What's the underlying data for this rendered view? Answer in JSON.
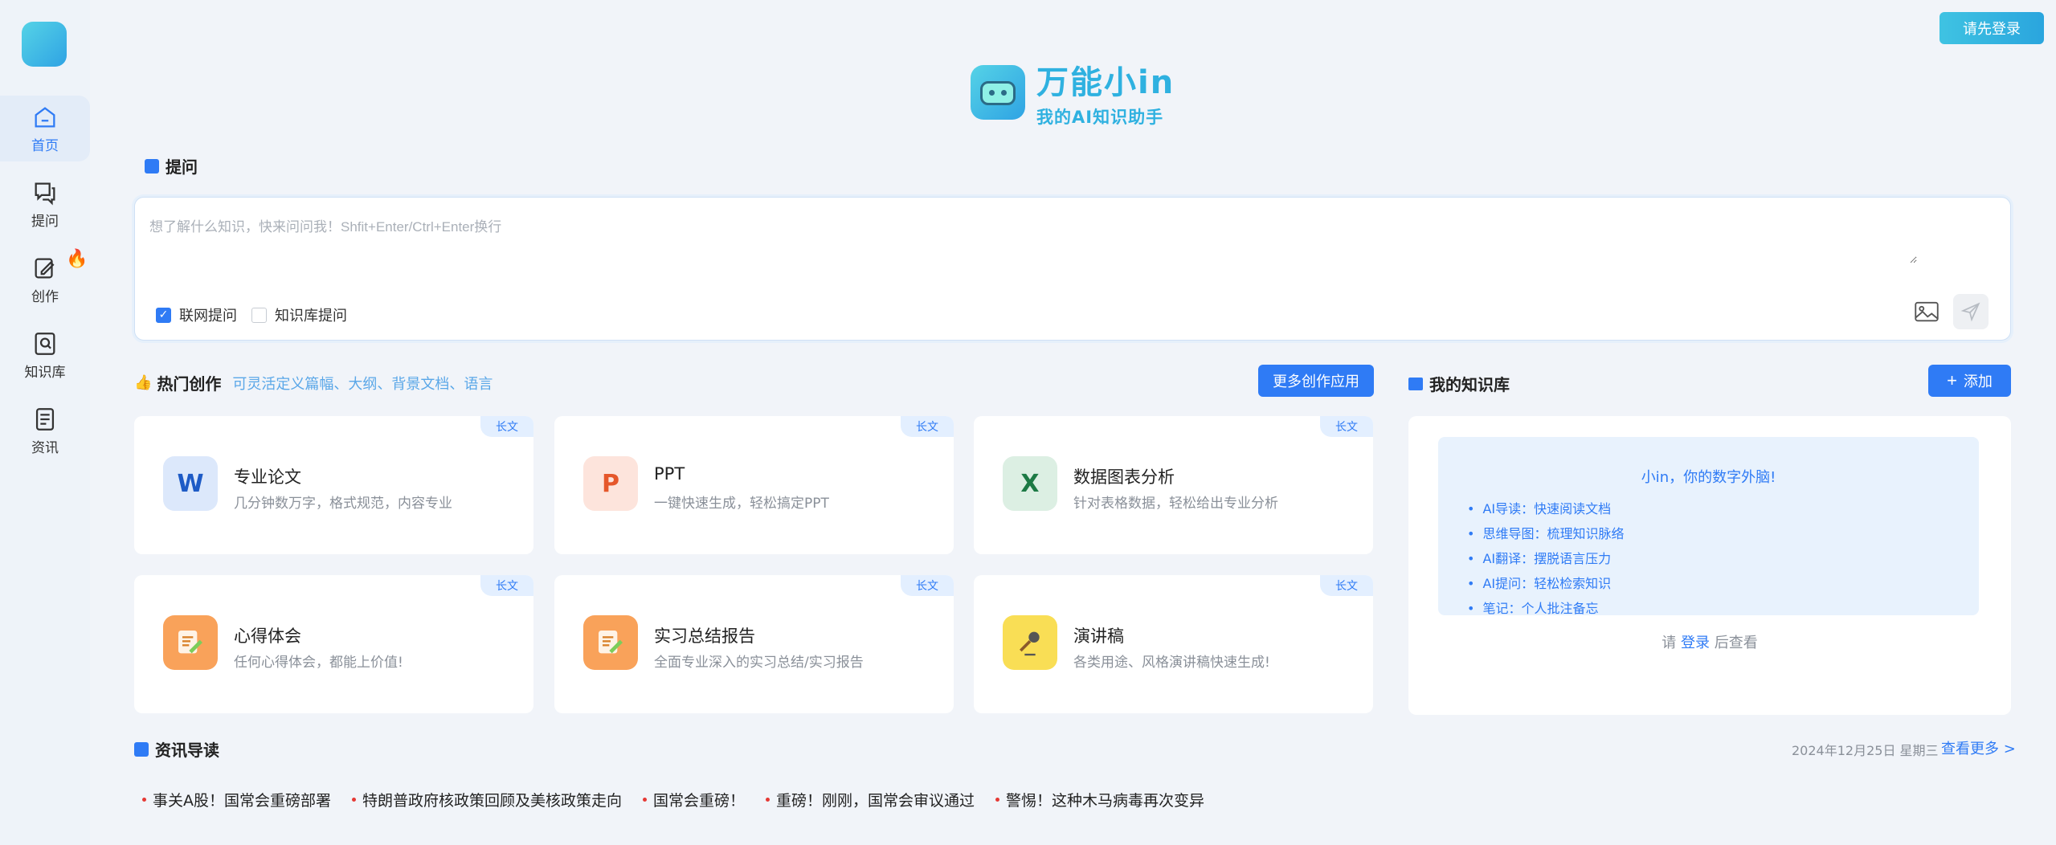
{
  "header": {
    "login_button": "请先登录"
  },
  "brand": {
    "title": "万能小in",
    "subtitle": "我的AI知识助手"
  },
  "sidebar": {
    "items": [
      {
        "label": "首页",
        "icon": "home-icon"
      },
      {
        "label": "提问",
        "icon": "chat-icon"
      },
      {
        "label": "创作",
        "icon": "edit-icon"
      },
      {
        "label": "知识库",
        "icon": "book-search-icon"
      },
      {
        "label": "资讯",
        "icon": "news-icon"
      }
    ],
    "hot_badge_icon": "fire-icon"
  },
  "ask": {
    "section_title": "提问",
    "placeholder": "想了解什么知识，快来问问我！Shfit+Enter/Ctrl+Enter换行",
    "options": [
      {
        "label": "联网提问",
        "checked": true
      },
      {
        "label": "知识库提问",
        "checked": false
      }
    ]
  },
  "hot": {
    "title": "热门创作",
    "subtitle": "可灵活定义篇幅、大纲、背景文档、语言",
    "more_button": "更多创作应用",
    "cards": [
      {
        "tag": "长文",
        "title": "专业论文",
        "desc": "几分钟数万字，格式规范，内容专业",
        "icon": "word-icon",
        "icon_text": "W"
      },
      {
        "tag": "长文",
        "title": "PPT",
        "desc": "一键快速生成，轻松搞定PPT",
        "icon": "powerpoint-icon",
        "icon_text": "P"
      },
      {
        "tag": "长文",
        "title": "数据图表分析",
        "desc": "针对表格数据，轻松给出专业分析",
        "icon": "excel-icon",
        "icon_text": "X"
      },
      {
        "tag": "长文",
        "title": "心得体会",
        "desc": "任何心得体会，都能上价值!",
        "icon": "document-pen-icon",
        "icon_text": ""
      },
      {
        "tag": "长文",
        "title": "实习总结报告",
        "desc": "全面专业深入的实习总结/实习报告",
        "icon": "document-pen-icon",
        "icon_text": ""
      },
      {
        "tag": "长文",
        "title": "演讲稿",
        "desc": "各类用途、风格演讲稿快速生成!",
        "icon": "microphone-icon",
        "icon_text": ""
      }
    ]
  },
  "knowledge": {
    "title": "我的知识库",
    "add_button": "添加",
    "headline": "小in，你的数字外脑!",
    "features": [
      "AI导读：快速阅读文档",
      "思维导图：梳理知识脉络",
      "AI翻译：摆脱语言压力",
      "AI提问：轻松检索知识",
      "笔记：个人批注备忘"
    ],
    "login_prefix": "请",
    "login_link": "登录",
    "login_suffix": "后查看"
  },
  "news": {
    "title": "资讯导读",
    "date": "2024年12月25日 星期三",
    "more_link": "查看更多 >",
    "items": [
      "事关A股！国常会重磅部署",
      "特朗普政府核政策回顾及美核政策走向",
      "国常会重磅！",
      "重磅！刚刚，国常会审议通过",
      "警惕！这种木马病毒再次变异"
    ]
  },
  "colors": {
    "primary": "#2f7bf5",
    "brand": "#2fb1e0",
    "sidebar_bg": "#eef3f9",
    "page_bg": "#f1f4f9"
  }
}
